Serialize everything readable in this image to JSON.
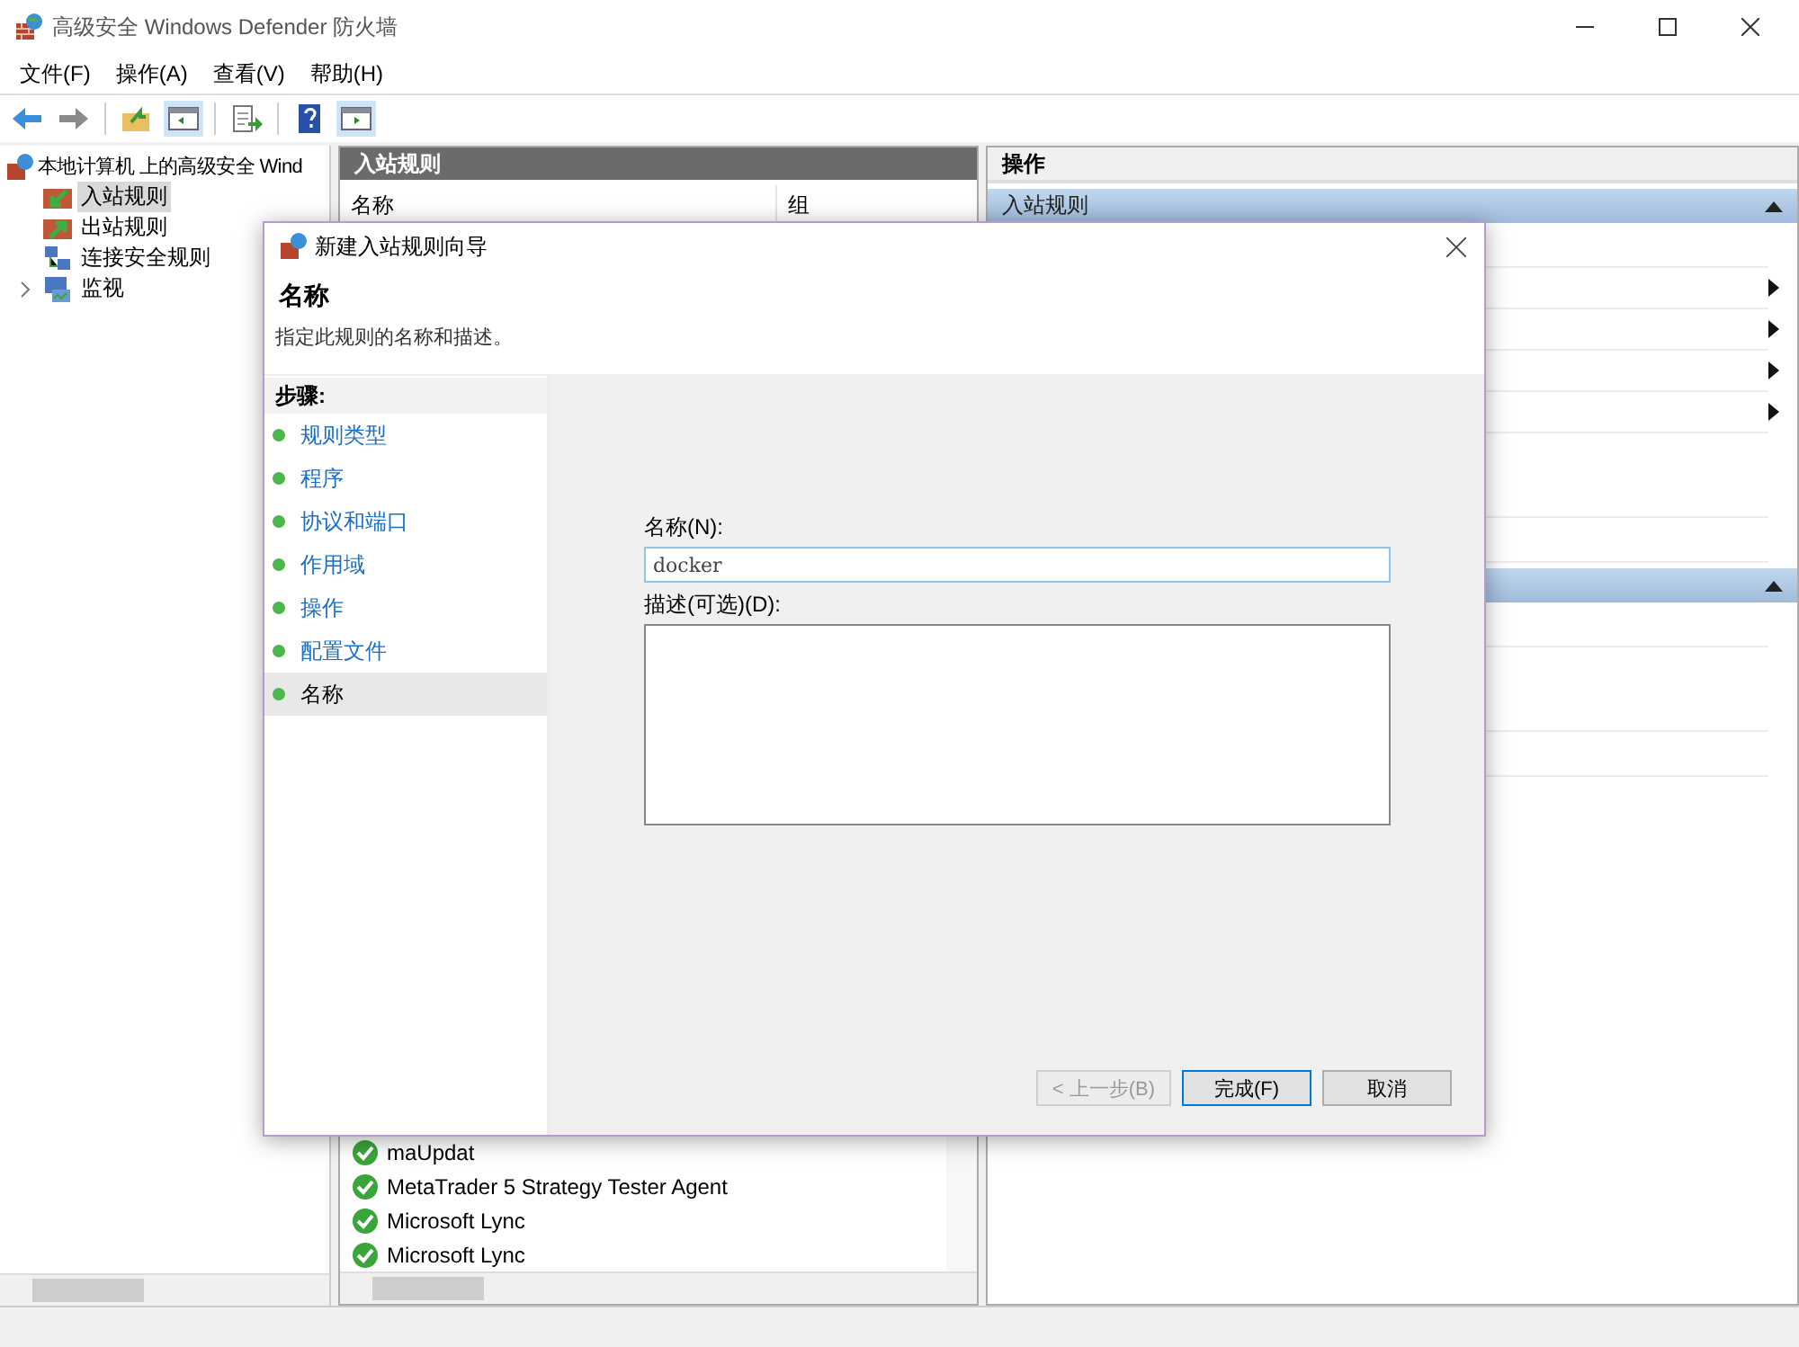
{
  "window": {
    "title": "高级安全 Windows Defender 防火墙"
  },
  "menu": [
    "文件(F)",
    "操作(A)",
    "查看(V)",
    "帮助(H)"
  ],
  "tree": {
    "label": "本地计算机 上的高级安全 Wind",
    "children": [
      {
        "label": "入站规则",
        "selected": true
      },
      {
        "label": "出站规则",
        "selected": false
      },
      {
        "label": "连接安全规则",
        "selected": false
      },
      {
        "label": "监视",
        "selected": false,
        "expanded": false
      }
    ]
  },
  "rules_panel": {
    "title": "入站规则",
    "columns": [
      "名称",
      "组"
    ],
    "rows": [
      {
        "name": "maUpdat",
        "enabled": true
      },
      {
        "name": "MetaTrader 5 Strategy Tester Agent",
        "enabled": true
      },
      {
        "name": "Microsoft Lync",
        "enabled": true
      },
      {
        "name": "Microsoft Lync",
        "enabled": true
      }
    ]
  },
  "actions_panel": {
    "title": "操作",
    "sections": [
      {
        "title": "入站规则",
        "expanded": true
      },
      {
        "expanded": true
      }
    ]
  },
  "dialog": {
    "title": "新建入站规则向导",
    "heading": "名称",
    "subtitle": "指定此规则的名称和描述。",
    "steps_label": "步骤:",
    "steps": [
      {
        "label": "规则类型",
        "selected": false
      },
      {
        "label": "程序",
        "selected": false
      },
      {
        "label": "协议和端口",
        "selected": false
      },
      {
        "label": "作用域",
        "selected": false
      },
      {
        "label": "操作",
        "selected": false
      },
      {
        "label": "配置文件",
        "selected": false
      },
      {
        "label": "名称",
        "selected": true
      }
    ],
    "name_label": "名称(N):",
    "name_value": "docker",
    "description_label": "描述(可选)(D):",
    "buttons": [
      {
        "label": "< 上一步(B)",
        "kind": "back",
        "disabled": true
      },
      {
        "label": "完成(F)",
        "kind": "finish",
        "disabled": false
      },
      {
        "label": "取消",
        "kind": "cancel",
        "disabled": false
      }
    ]
  }
}
